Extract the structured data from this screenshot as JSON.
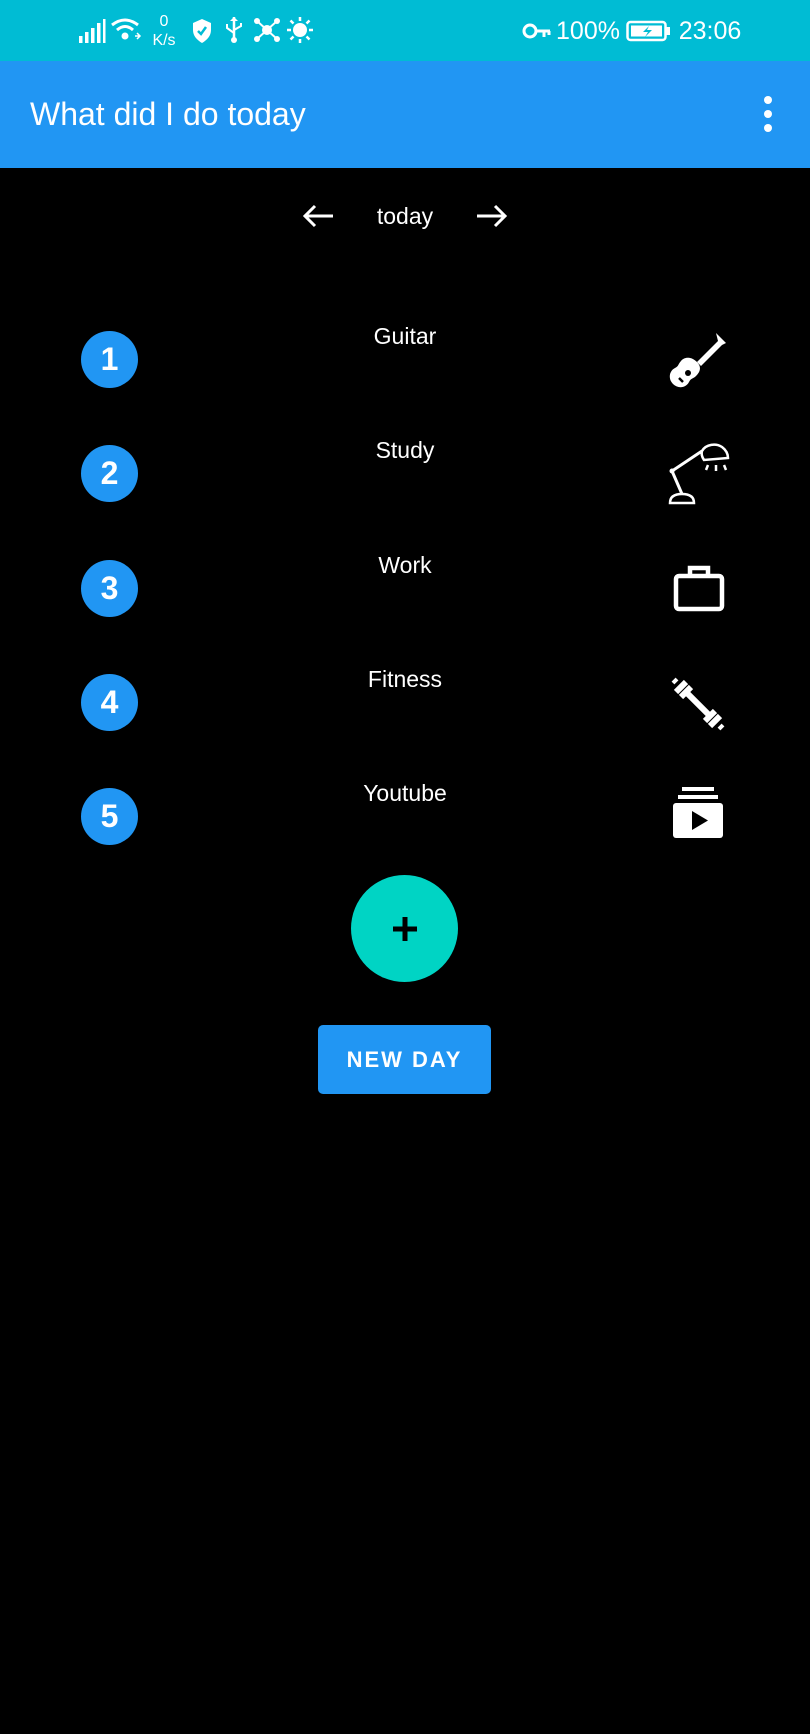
{
  "status_bar": {
    "network_speed_value": "0",
    "network_speed_unit": "K/s",
    "battery_percent": "100%",
    "time": "23:06",
    "background_color": "#00BCD4"
  },
  "app_bar": {
    "title": "What did I do today",
    "background_color": "#2196F3",
    "menu_icon": "more-vert-icon"
  },
  "day_nav": {
    "label": "today",
    "prev_icon": "arrow-left-icon",
    "next_icon": "arrow-right-icon"
  },
  "activities": [
    {
      "number": "1",
      "label": "Guitar",
      "icon": "guitar-icon"
    },
    {
      "number": "2",
      "label": "Study",
      "icon": "desk-lamp-icon"
    },
    {
      "number": "3",
      "label": "Work",
      "icon": "briefcase-icon"
    },
    {
      "number": "4",
      "label": "Fitness",
      "icon": "dumbbell-icon"
    },
    {
      "number": "5",
      "label": "Youtube",
      "icon": "video-library-icon"
    }
  ],
  "fab": {
    "icon": "plus-icon",
    "color": "#00D4C4"
  },
  "new_day_button": {
    "label": "NEW DAY",
    "color": "#2196F3"
  }
}
